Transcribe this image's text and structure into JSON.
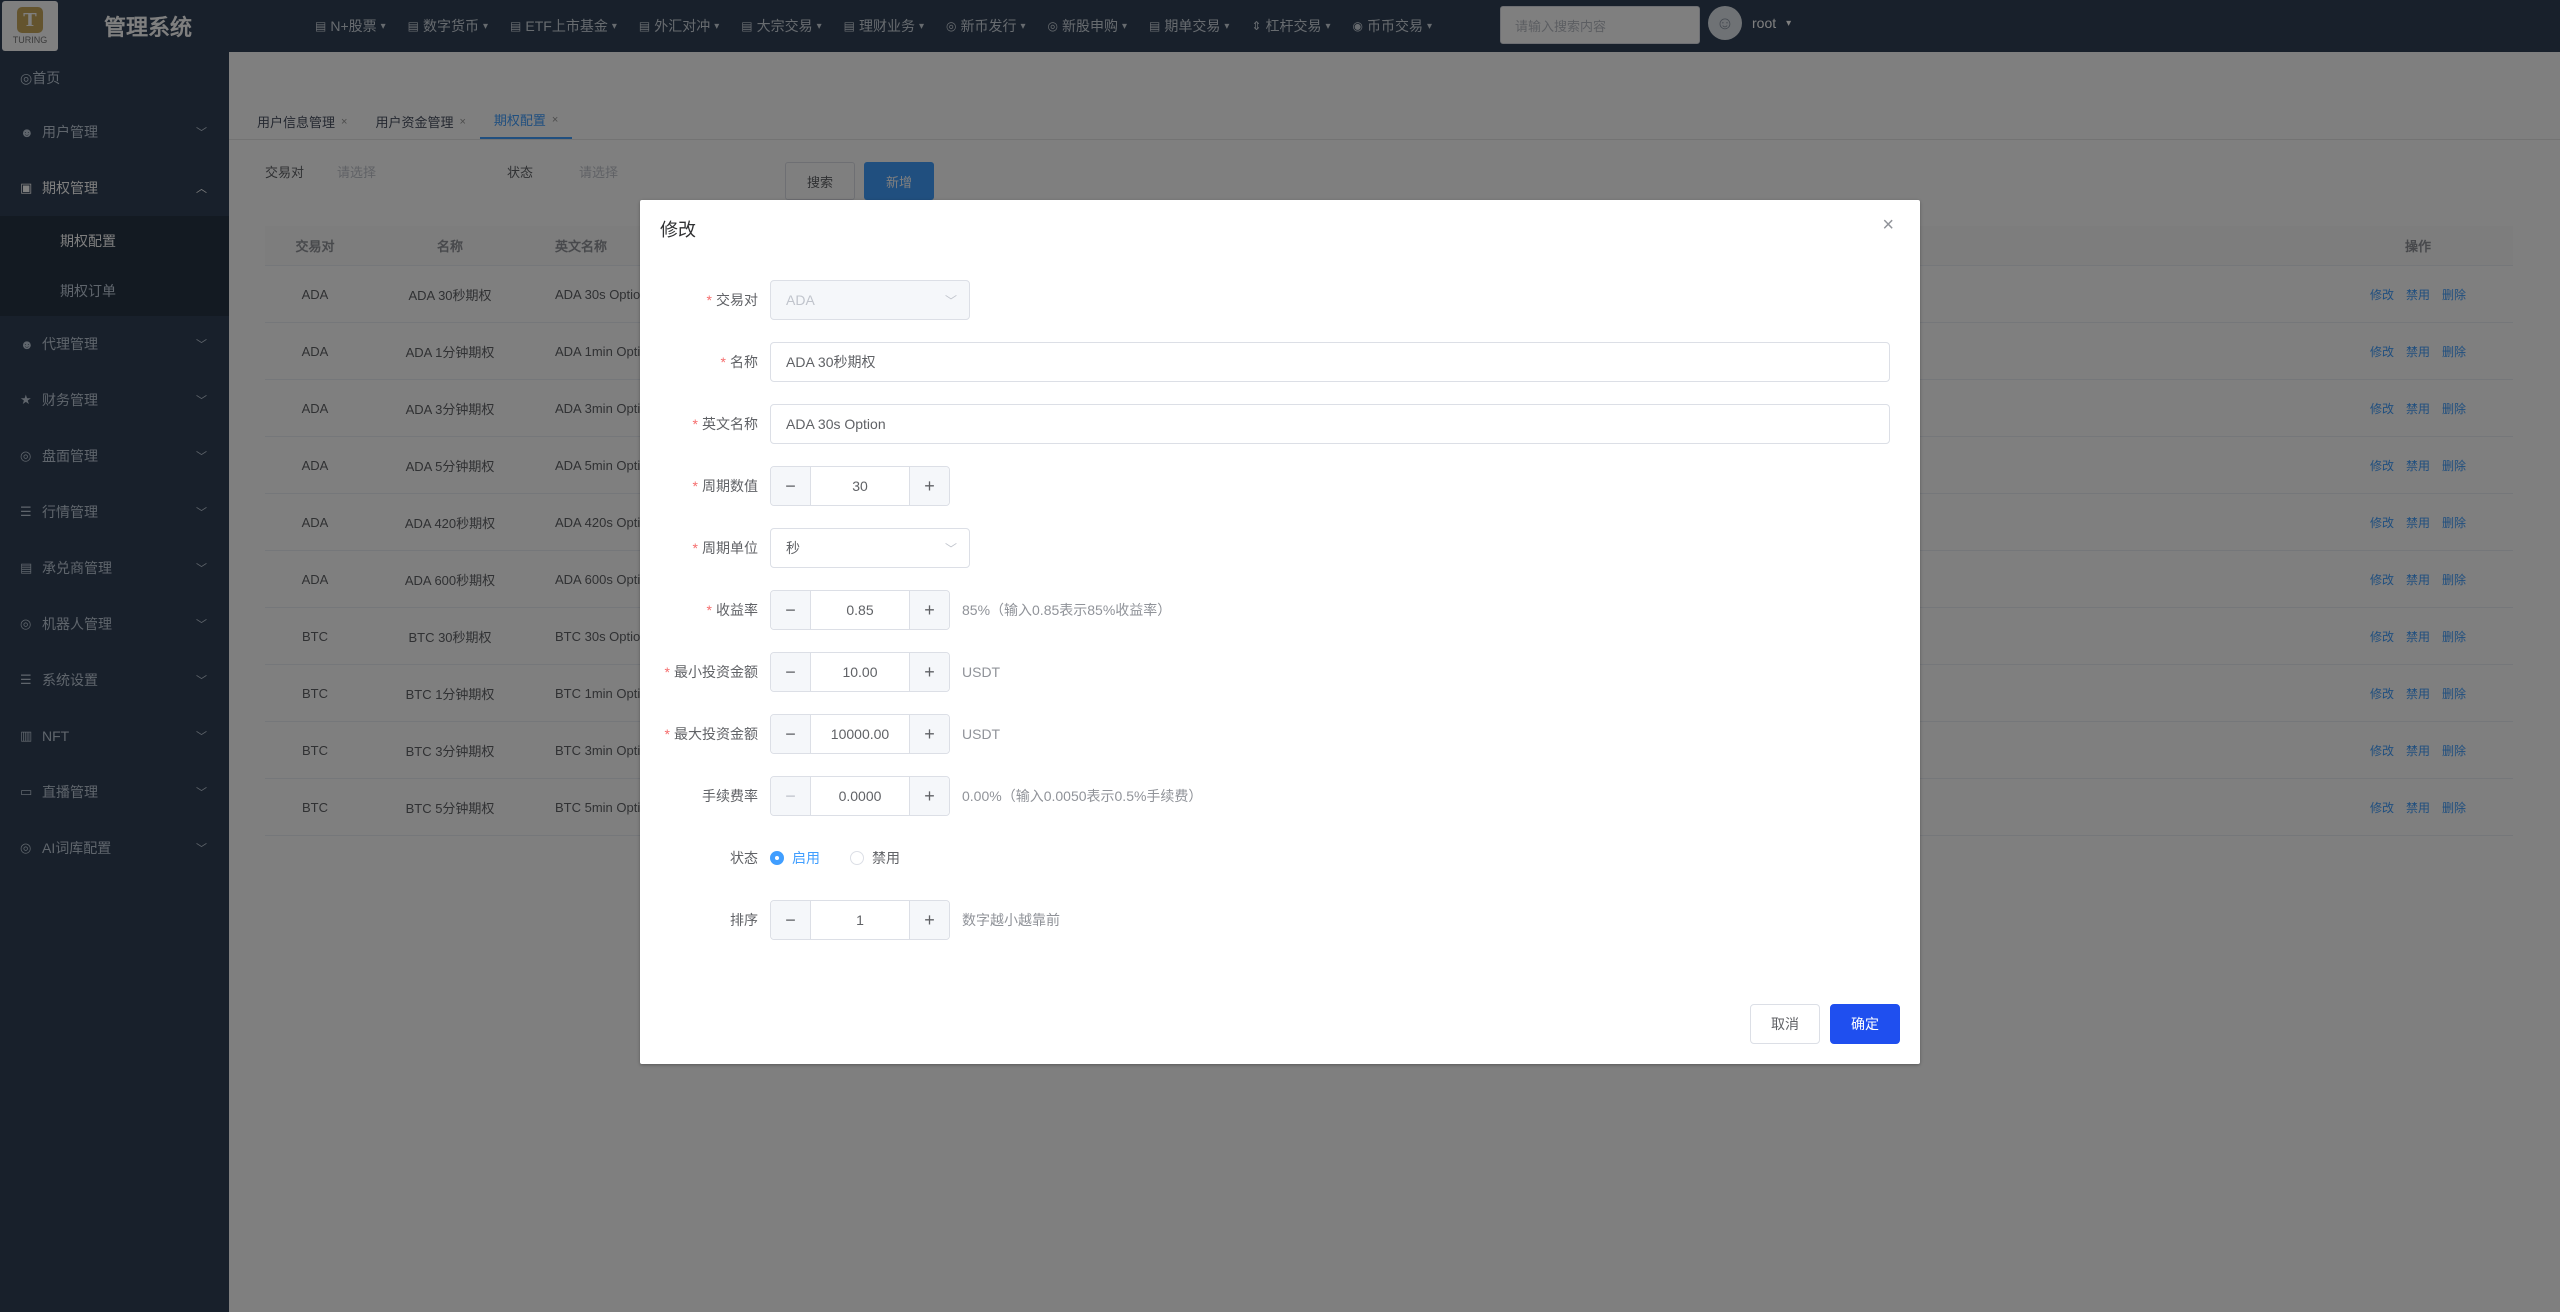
{
  "app": {
    "logo_text": "TURING",
    "title": "管理系统"
  },
  "topnav": [
    {
      "icon": "▤",
      "label": "N+股票"
    },
    {
      "icon": "▤",
      "label": "数字货币"
    },
    {
      "icon": "▤",
      "label": "ETF上市基金"
    },
    {
      "icon": "▤",
      "label": "外汇对冲"
    },
    {
      "icon": "▤",
      "label": "大宗交易"
    },
    {
      "icon": "▤",
      "label": "理财业务"
    },
    {
      "icon": "◎",
      "label": "新币发行"
    },
    {
      "icon": "◎",
      "label": "新股申购"
    },
    {
      "icon": "▤",
      "label": "期单交易"
    },
    {
      "icon": "⇕",
      "label": "杠杆交易"
    },
    {
      "icon": "◉",
      "label": "币币交易"
    }
  ],
  "search": {
    "placeholder": "请输入搜索内容"
  },
  "user": {
    "name": "root"
  },
  "sidebar": {
    "home": "首页",
    "items": [
      {
        "label": "用户管理",
        "open": false
      },
      {
        "label": "期权管理",
        "open": true
      },
      {
        "label": "代理管理",
        "open": false
      },
      {
        "label": "财务管理",
        "open": false
      },
      {
        "label": "盘面管理",
        "open": false
      },
      {
        "label": "行情管理",
        "open": false
      },
      {
        "label": "承兑商管理",
        "open": false
      },
      {
        "label": "机器人管理",
        "open": false
      },
      {
        "label": "系统设置",
        "open": false
      },
      {
        "label": "NFT",
        "open": false
      },
      {
        "label": "直播管理",
        "open": false
      },
      {
        "label": "AI词库配置",
        "open": false
      }
    ],
    "sub_items": [
      "期权配置",
      "期权订单"
    ]
  },
  "tabs": [
    {
      "label": "用户信息管理",
      "active": false
    },
    {
      "label": "用户资金管理",
      "active": false
    },
    {
      "label": "期权配置",
      "active": true
    }
  ],
  "filter": {
    "pair_label": "交易对",
    "pair_placeholder": "请选择",
    "status_label": "状态",
    "status_placeholder": "请选择",
    "search_button": "搜索",
    "add_button": "新增"
  },
  "table": {
    "headers": {
      "pair": "交易对",
      "name": "名称",
      "en_name": "英文名称",
      "ops": "操作"
    },
    "op_labels": {
      "edit": "修改",
      "disable": "禁用",
      "delete": "删除"
    },
    "rows": [
      {
        "pair": "ADA",
        "name": "ADA 30秒期权",
        "en_name": "ADA 30s Option"
      },
      {
        "pair": "ADA",
        "name": "ADA 1分钟期权",
        "en_name": "ADA 1min Option"
      },
      {
        "pair": "ADA",
        "name": "ADA 3分钟期权",
        "en_name": "ADA 3min Option"
      },
      {
        "pair": "ADA",
        "name": "ADA 5分钟期权",
        "en_name": "ADA 5min Option"
      },
      {
        "pair": "ADA",
        "name": "ADA 420秒期权",
        "en_name": "ADA 420s Option"
      },
      {
        "pair": "ADA",
        "name": "ADA 600秒期权",
        "en_name": "ADA 600s Option"
      },
      {
        "pair": "BTC",
        "name": "BTC 30秒期权",
        "en_name": "BTC 30s Option"
      },
      {
        "pair": "BTC",
        "name": "BTC 1分钟期权",
        "en_name": "BTC 1min Option"
      },
      {
        "pair": "BTC",
        "name": "BTC 3分钟期权",
        "en_name": "BTC 3min Option"
      },
      {
        "pair": "BTC",
        "name": "BTC 5分钟期权",
        "en_name": "BTC 5min Option"
      }
    ]
  },
  "dialog": {
    "title": "修改",
    "close": "×",
    "fields": {
      "pair": {
        "label": "交易对",
        "value": "ADA"
      },
      "name": {
        "label": "名称",
        "value": "ADA 30秒期权"
      },
      "en_name": {
        "label": "英文名称",
        "value": "ADA 30s Option"
      },
      "period_value": {
        "label": "周期数值",
        "value": "30"
      },
      "period_unit": {
        "label": "周期单位",
        "value": "秒"
      },
      "profit_rate": {
        "label": "收益率",
        "value": "0.85",
        "hint": "85%（输入0.85表示85%收益率）"
      },
      "min_invest": {
        "label": "最小投资金额",
        "value": "10.00",
        "hint": "USDT"
      },
      "max_invest": {
        "label": "最大投资金额",
        "value": "10000.00",
        "hint": "USDT"
      },
      "fee_rate": {
        "label": "手续费率",
        "value": "0.0000",
        "hint": "0.00%（输入0.0050表示0.5%手续费）"
      },
      "status": {
        "label": "状态",
        "options": [
          "启用",
          "禁用"
        ],
        "selected": "启用"
      },
      "sort": {
        "label": "排序",
        "value": "1",
        "hint": "数字越小越靠前"
      }
    },
    "cancel_button": "取消",
    "confirm_button": "确定"
  },
  "colors": {
    "primary": "#409eff",
    "confirm": "#1f4fef",
    "required": "#f56c6c",
    "sidebar_bg": "#304156"
  }
}
